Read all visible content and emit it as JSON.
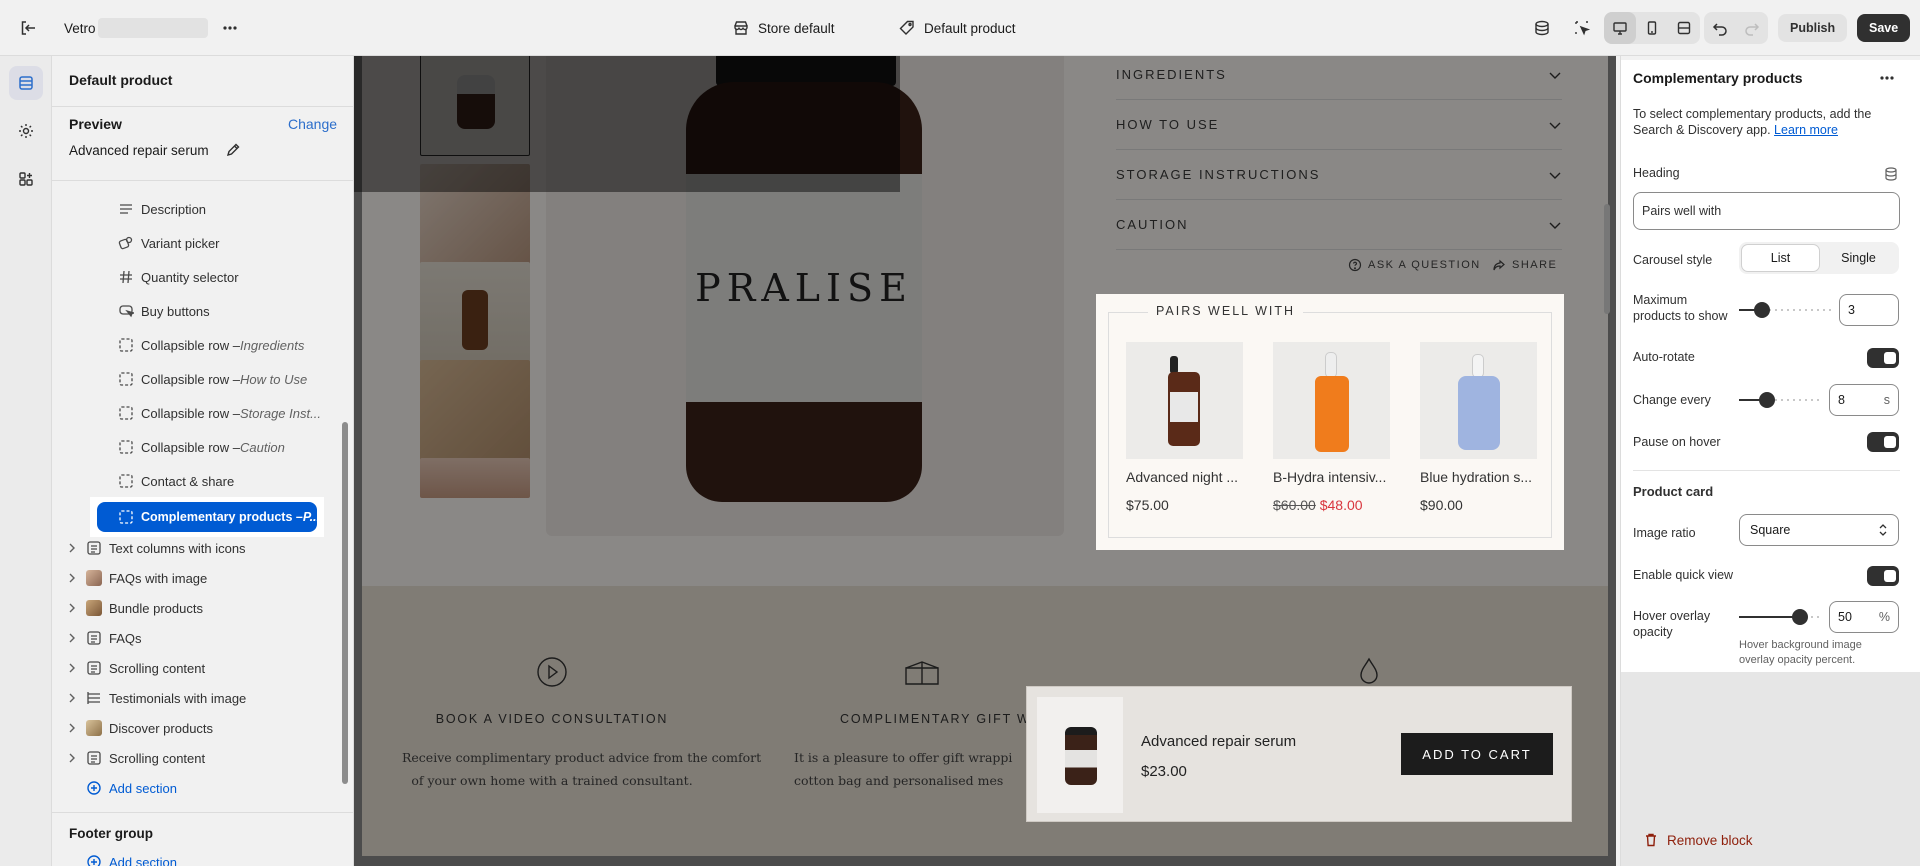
{
  "topbar": {
    "store_name": "Vetro",
    "theme_selector": "Store default",
    "template_selector": "Default product",
    "publish_label": "Publish",
    "save_label": "Save"
  },
  "left_panel": {
    "title": "Default product",
    "preview_label": "Preview",
    "change_label": "Change",
    "preview_product": "Advanced repair serum",
    "blocks": [
      {
        "label": "Description",
        "detail": "",
        "icon": "text-icon"
      },
      {
        "label": "Variant picker",
        "detail": "",
        "icon": "variant-icon"
      },
      {
        "label": "Quantity selector",
        "detail": "",
        "icon": "hash-icon"
      },
      {
        "label": "Buy buttons",
        "detail": "",
        "icon": "buy-icon"
      },
      {
        "label": "Collapsible row – ",
        "detail": "Ingredients",
        "icon": "collapsible-icon"
      },
      {
        "label": "Collapsible row – ",
        "detail": "How to Use",
        "icon": "collapsible-icon"
      },
      {
        "label": "Collapsible row – ",
        "detail": "Storage Inst...",
        "icon": "collapsible-icon"
      },
      {
        "label": "Collapsible row – ",
        "detail": "Caution",
        "icon": "collapsible-icon"
      },
      {
        "label": "Contact & share",
        "detail": "",
        "icon": "collapsible-icon"
      }
    ],
    "selected_block": {
      "label": "Complementary products – ",
      "detail": "P..."
    },
    "sections": [
      {
        "label": "Text columns with icons",
        "icon": "section-icon"
      },
      {
        "label": "FAQs with image",
        "icon": "image-section-icon"
      },
      {
        "label": "Bundle products",
        "icon": "image-section-icon"
      },
      {
        "label": "FAQs",
        "icon": "section-icon"
      },
      {
        "label": "Scrolling content",
        "icon": "section-icon"
      },
      {
        "label": "Testimonials with image",
        "icon": "section-icon"
      },
      {
        "label": "Discover products",
        "icon": "image-section-icon"
      },
      {
        "label": "Scrolling content",
        "icon": "section-icon"
      }
    ],
    "add_section_label": "Add section",
    "footer_group_label": "Footer group",
    "footer_add_section_label": "Add section"
  },
  "preview": {
    "brand_label": "PRALISE",
    "accordions": [
      "INGREDIENTS",
      "HOW TO USE",
      "STORAGE INSTRUCTIONS",
      "CAUTION"
    ],
    "ask_question": "ASK A QUESTION",
    "share": "SHARE",
    "complementary": {
      "heading": "PAIRS WELL WITH",
      "products": [
        {
          "name": "Advanced night ...",
          "price": "$75.00",
          "compare_price": "",
          "sale_price": ""
        },
        {
          "name": "B-Hydra intensiv...",
          "price": "",
          "compare_price": "$60.00",
          "sale_price": "$48.00"
        },
        {
          "name": "Blue hydration s...",
          "price": "$90.00",
          "compare_price": "",
          "sale_price": ""
        }
      ]
    },
    "features": [
      {
        "title": "BOOK A VIDEO CONSULTATION",
        "text_1": "Receive complimentary product advice from the comfort",
        "text_2": "of your own home with a trained consultant."
      },
      {
        "title": "COMPLIMENTARY GIFT W",
        "text_1": "It is a pleasure to offer gift wrappi",
        "text_2": "cotton bag and personalised mes"
      }
    ],
    "sticky_cart": {
      "product": "Advanced repair serum",
      "price": "$23.00",
      "button": "ADD TO CART"
    }
  },
  "settings": {
    "title": "Complementary products",
    "help_text": "To select complementary products, add the Search & Discovery app.",
    "learn_more": "Learn more",
    "heading_label": "Heading",
    "heading_value": "Pairs well with",
    "carousel_label": "Carousel style",
    "carousel_options": [
      "List",
      "Single"
    ],
    "carousel_selected": "List",
    "max_products_label": "Maximum products to show",
    "max_products_value": "3",
    "max_products_fraction": 0.2,
    "auto_rotate_label": "Auto-rotate",
    "auto_rotate": true,
    "change_every_label": "Change every",
    "change_every_value": "8",
    "change_every_unit": "s",
    "change_every_fraction": 0.3,
    "pause_hover_label": "Pause on hover",
    "pause_hover": true,
    "product_card_label": "Product card",
    "image_ratio_label": "Image ratio",
    "image_ratio_value": "Square",
    "quick_view_label": "Enable quick view",
    "quick_view": true,
    "hover_opacity_label": "Hover overlay opacity",
    "hover_opacity_value": "50",
    "hover_opacity_unit": "%",
    "hover_opacity_fraction": 0.8,
    "hover_opacity_help": "Hover background image overlay opacity percent.",
    "remove_block_label": "Remove block"
  }
}
